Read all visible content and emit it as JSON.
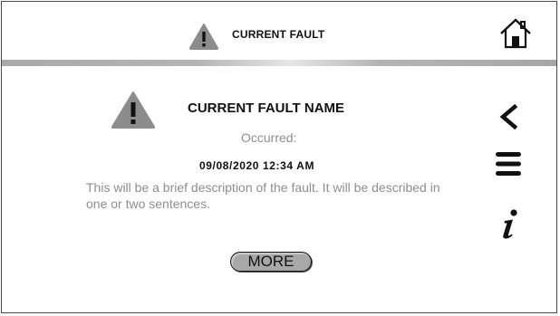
{
  "header": {
    "title": "CURRENT FAULT",
    "warning_icon": "warning-triangle-icon",
    "home_icon": "home-icon"
  },
  "fault": {
    "name": "CURRENT FAULT NAME",
    "occurred_label": "Occurred:",
    "timestamp": "09/08/2020 12:34 AM",
    "description": "This will be a brief description of the fault. It will be described in one or two sentences.",
    "icon": "warning-triangle-icon"
  },
  "actions": {
    "more_label": "MORE"
  },
  "side_nav": {
    "back_icon": "chevron-left-icon",
    "menu_icon": "hamburger-menu-icon",
    "info_icon": "info-icon"
  },
  "colors": {
    "icon_gray": "#8c8c8c",
    "text_dark": "#111111",
    "text_gray": "#8e8e8e",
    "button_gray": "#a8a8a8"
  }
}
